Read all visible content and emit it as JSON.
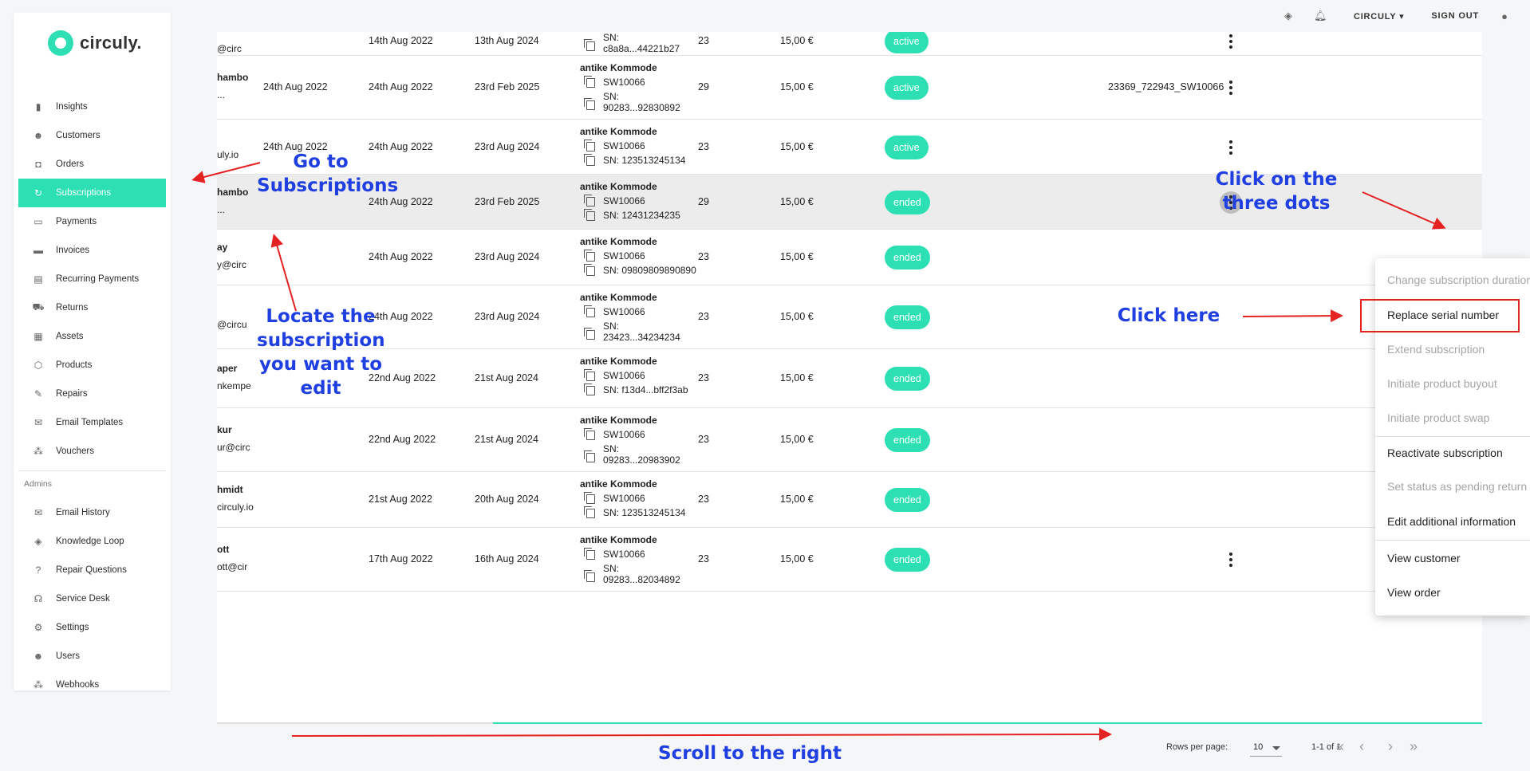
{
  "sidebar": {
    "logo": "circuly.",
    "items": [
      {
        "label": "Insights",
        "icon": "bar-chart-icon",
        "glyph": "▮"
      },
      {
        "label": "Customers",
        "icon": "people-icon",
        "glyph": "☻"
      },
      {
        "label": "Orders",
        "icon": "bag-icon",
        "glyph": "◘"
      },
      {
        "label": "Subscriptions",
        "icon": "sync-icon",
        "glyph": "↻",
        "active": true
      },
      {
        "label": "Payments",
        "icon": "card-icon",
        "glyph": "▭"
      },
      {
        "label": "Invoices",
        "icon": "invoice-icon",
        "glyph": "▬"
      },
      {
        "label": "Recurring Payments",
        "icon": "recurring-icon",
        "glyph": "▤"
      },
      {
        "label": "Returns",
        "icon": "truck-icon",
        "glyph": "⛟"
      },
      {
        "label": "Assets",
        "icon": "assets-icon",
        "glyph": "▦"
      },
      {
        "label": "Products",
        "icon": "box-icon",
        "glyph": "⬡"
      },
      {
        "label": "Repairs",
        "icon": "wrench-icon",
        "glyph": "✎"
      },
      {
        "label": "Email Templates",
        "icon": "mail-icon",
        "glyph": "✉"
      },
      {
        "label": "Vouchers",
        "icon": "vouchers-icon",
        "glyph": "⁂"
      }
    ],
    "admins_label": "Admins",
    "admin_items": [
      {
        "label": "Email History",
        "icon": "mail-icon",
        "glyph": "✉"
      },
      {
        "label": "Knowledge Loop",
        "icon": "graduation-cap-icon",
        "glyph": "◈"
      },
      {
        "label": "Repair Questions",
        "icon": "question-icon",
        "glyph": "?"
      },
      {
        "label": "Service Desk",
        "icon": "headset-icon",
        "glyph": "☊"
      },
      {
        "label": "Settings",
        "icon": "gear-icon",
        "glyph": "⚙"
      },
      {
        "label": "Users",
        "icon": "people-icon",
        "glyph": "☻"
      },
      {
        "label": "Webhooks",
        "icon": "webhook-icon",
        "glyph": "⁂"
      }
    ]
  },
  "topbar": {
    "account": "CIRCULY",
    "sign_out": "SIGN OUT"
  },
  "rows": [
    {
      "name": "",
      "email": "@circ",
      "created": "",
      "start": "14th Aug 2022",
      "end": "13th Aug 2024",
      "product": "",
      "sku": "",
      "sn_prefix": "SN:",
      "sn": "c8a8a...44221b27",
      "duration": "23",
      "price": "15,00 €",
      "status": "active",
      "serial_ref": "",
      "dots": true
    },
    {
      "name": "hambo",
      "email": "...",
      "created": "24th Aug 2022",
      "start": "24th Aug 2022",
      "end": "23rd Feb 2025",
      "product": "antike Kommode",
      "sku": "SW10066",
      "sn_prefix": "SN:",
      "sn": "90283...92830892",
      "duration": "29",
      "price": "15,00 €",
      "status": "active",
      "serial_ref": "23369_722943_SW10066",
      "dots": true
    },
    {
      "name": "",
      "email": "uly.io",
      "created": "24th Aug 2022",
      "start": "24th Aug 2022",
      "end": "23rd Aug 2024",
      "product": "antike Kommode",
      "sku": "SW10066",
      "sn_prefix": "",
      "sn": "SN: 123513245134",
      "duration": "23",
      "price": "15,00 €",
      "status": "active",
      "serial_ref": "",
      "dots": true
    },
    {
      "name": "hambo",
      "email": "...",
      "created": "",
      "start": "24th Aug 2022",
      "end": "23rd Feb 2025",
      "product": "antike Kommode",
      "sku": "SW10066",
      "sn_prefix": "",
      "sn": "SN: 12431234235",
      "duration": "29",
      "price": "15,00 €",
      "status": "ended",
      "serial_ref": "",
      "dots": true
    },
    {
      "name": "ay",
      "email": "y@circ",
      "created": "",
      "start": "24th Aug 2022",
      "end": "23rd Aug 2024",
      "product": "antike Kommode",
      "sku": "SW10066",
      "sn_prefix": "",
      "sn": "SN: 09809809890890",
      "duration": "23",
      "price": "15,00 €",
      "status": "ended",
      "serial_ref": "",
      "dots": false
    },
    {
      "name": "",
      "email": "@circu",
      "created": "",
      "start": "24th Aug 2022",
      "end": "23rd Aug 2024",
      "product": "antike Kommode",
      "sku": "SW10066",
      "sn_prefix": "SN:",
      "sn": "23423...34234234",
      "duration": "23",
      "price": "15,00 €",
      "status": "ended",
      "serial_ref": "",
      "dots": false
    },
    {
      "name": "aper",
      "email": "nkempe",
      "created": "",
      "start": "22nd Aug 2022",
      "end": "21st Aug 2024",
      "product": "antike Kommode",
      "sku": "SW10066",
      "sn_prefix": "",
      "sn": "SN: f13d4...bff2f3ab",
      "duration": "23",
      "price": "15,00 €",
      "status": "ended",
      "serial_ref": "",
      "dots": false
    },
    {
      "name": "kur",
      "email": "ur@circ",
      "created": "",
      "start": "22nd Aug 2022",
      "end": "21st Aug 2024",
      "product": "antike Kommode",
      "sku": "SW10066",
      "sn_prefix": "SN:",
      "sn": "09283...20983902",
      "duration": "23",
      "price": "15,00 €",
      "status": "ended",
      "serial_ref": "",
      "dots": false
    },
    {
      "name": "hmidt",
      "email": "circuly.io",
      "created": "",
      "start": "21st Aug 2022",
      "end": "20th Aug 2024",
      "product": "antike Kommode",
      "sku": "SW10066",
      "sn_prefix": "",
      "sn": "SN: 123513245134",
      "duration": "23",
      "price": "15,00 €",
      "status": "ended",
      "serial_ref": "",
      "dots": false
    },
    {
      "name": "ott",
      "email": "ott@cir",
      "created": "",
      "start": "17th Aug 2022",
      "end": "16th Aug 2024",
      "product": "antike Kommode",
      "sku": "SW10066",
      "sn_prefix": "SN:",
      "sn": "09283...82034892",
      "duration": "23",
      "price": "15,00 €",
      "status": "ended",
      "serial_ref": "",
      "dots": true
    }
  ],
  "menu": {
    "items": [
      {
        "label": "Change subscription duration",
        "disabled": true
      },
      {
        "label": "Replace serial number",
        "disabled": false
      },
      {
        "label": "Extend subscription",
        "disabled": true
      },
      {
        "label": "Initiate product buyout",
        "disabled": true
      },
      {
        "label": "Initiate product swap",
        "disabled": true
      },
      {
        "label": "Reactivate subscription",
        "disabled": false
      },
      {
        "label": "Set status as pending return",
        "disabled": true
      },
      {
        "label": "Edit additional information",
        "disabled": false
      },
      {
        "label": "View customer",
        "disabled": false
      },
      {
        "label": "View order",
        "disabled": false
      }
    ]
  },
  "pagination": {
    "rows_per_page_label": "Rows per page:",
    "rows_per_page": "10",
    "range": "1-1 of 1"
  },
  "annotations": {
    "go_to": "Go to\nSubscriptions",
    "locate": "Locate the\nsubscription\nyou want to\nedit",
    "three_dots": "Click on the\nthree dots",
    "click_here": "Click here",
    "scroll": "Scroll to the right"
  },
  "colors": {
    "accent": "#2de0b4",
    "annotation": "#1f3fe0",
    "arrow": "#e52222"
  }
}
